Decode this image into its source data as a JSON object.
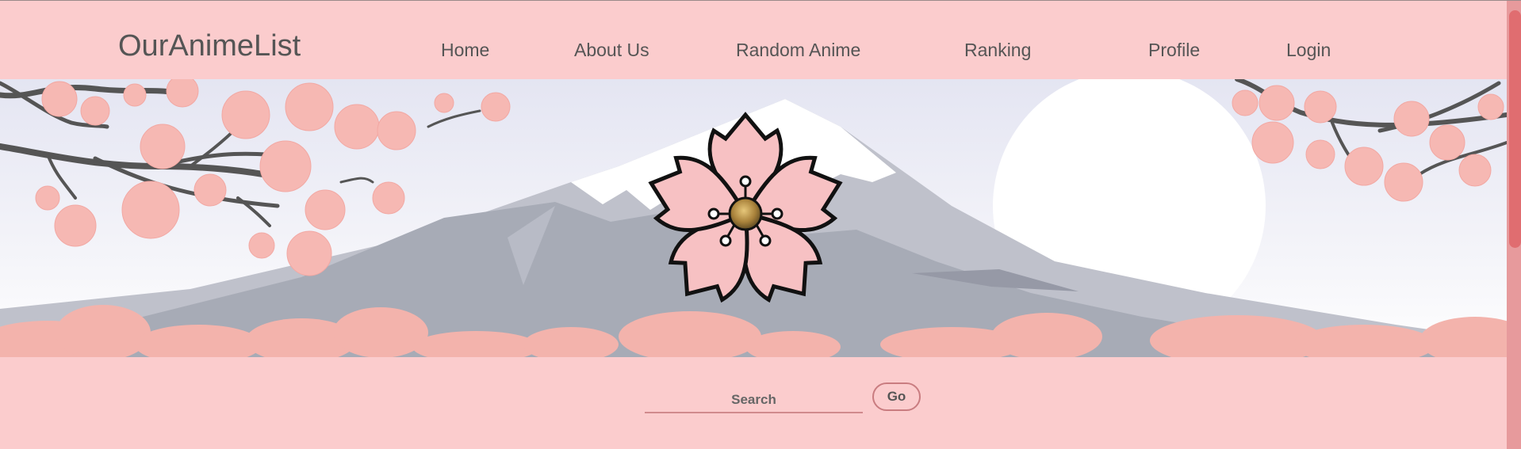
{
  "header": {
    "brand": "OurAnimeList",
    "nav": [
      {
        "label": "Home"
      },
      {
        "label": "About Us"
      },
      {
        "label": "Random Anime"
      },
      {
        "label": "Ranking"
      },
      {
        "label": "Profile"
      },
      {
        "label": "Login"
      }
    ]
  },
  "banner": {
    "logo_icon": "cherry-blossom-icon",
    "scene": "mountain-with-cherry-blossoms"
  },
  "search": {
    "placeholder": "Search",
    "value": "",
    "go_label": "Go"
  },
  "colors": {
    "background": "#fbcccd",
    "accent": "#e06d70",
    "text": "#555555"
  }
}
